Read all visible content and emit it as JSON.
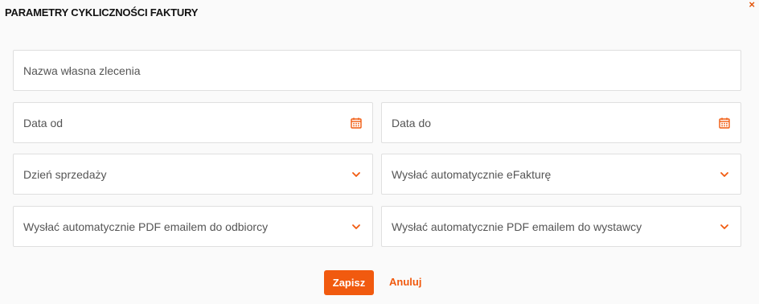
{
  "dialog": {
    "title": "PARAMETRY CYKLICZNOŚCI FAKTURY",
    "close_glyph": "×"
  },
  "fields": {
    "name": {
      "placeholder": "Nazwa własna zlecenia"
    },
    "date_from": {
      "placeholder": "Data od",
      "icon": "calendar-icon"
    },
    "date_to": {
      "placeholder": "Data do",
      "icon": "calendar-icon"
    },
    "sale_day": {
      "placeholder": "Dzień sprzedaży",
      "icon": "chevron-down-icon"
    },
    "auto_efaktura": {
      "placeholder": "Wysłać automatycznie eFakturę",
      "icon": "chevron-down-icon"
    },
    "auto_pdf_recipient": {
      "placeholder": "Wysłać automatycznie PDF emailem do odbiorcy",
      "icon": "chevron-down-icon"
    },
    "auto_pdf_issuer": {
      "placeholder": "Wysłać automatycznie PDF emailem do wystawcy",
      "icon": "chevron-down-icon"
    }
  },
  "actions": {
    "save_label": "Zapisz",
    "cancel_label": "Anuluj"
  },
  "colors": {
    "accent": "#f15a0f",
    "border": "#dfdfdf",
    "background": "#fafafa"
  }
}
